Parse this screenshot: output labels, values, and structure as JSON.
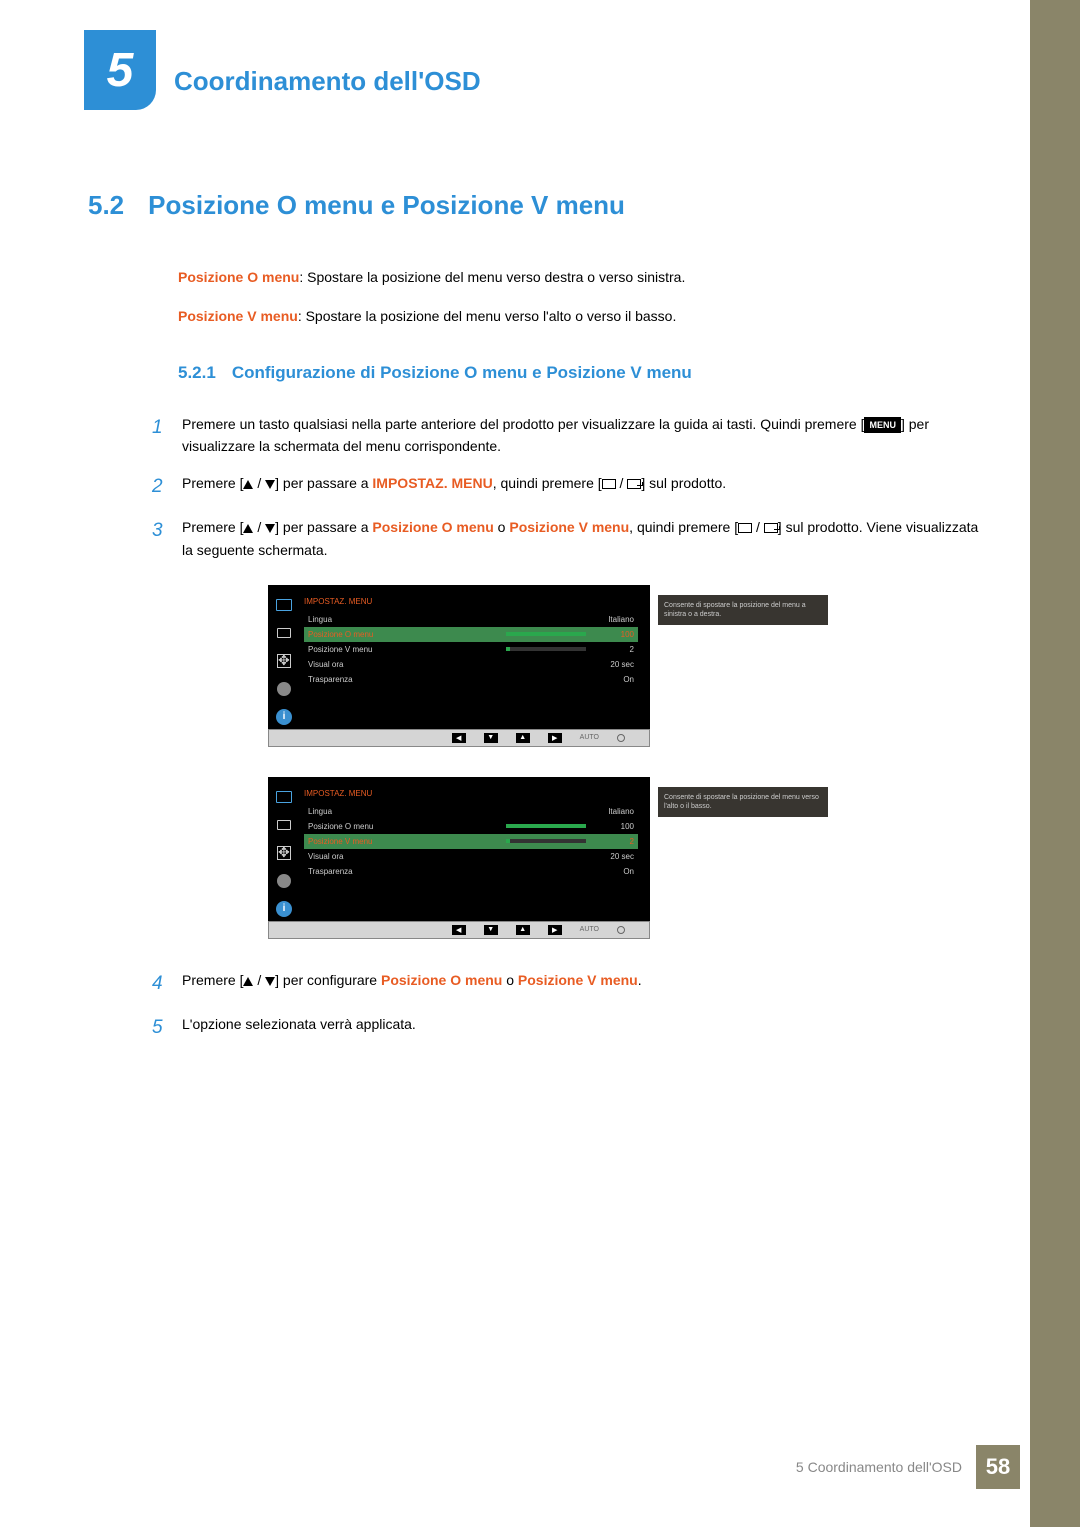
{
  "chapter": {
    "num": "5",
    "title": "Coordinamento dell'OSD"
  },
  "section": {
    "num": "5.2",
    "title": "Posizione O menu e Posizione V menu"
  },
  "paras": {
    "p1key": "Posizione O menu",
    "p1": ": Spostare la posizione del menu verso destra o verso sinistra.",
    "p2key": "Posizione V menu",
    "p2": ": Spostare la posizione del menu verso l'alto o verso il basso."
  },
  "subsection": {
    "num": "5.2.1",
    "title": "Configurazione di Posizione O menu e Posizione V menu"
  },
  "steps": {
    "s1a": "Premere un tasto qualsiasi nella parte anteriore del prodotto per visualizzare la guida ai tasti. Quindi premere [",
    "s1b": "] per visualizzare la schermata del menu corrispondente.",
    "s2a": "Premere [",
    "s2b": "] per passare a ",
    "s2key": "IMPOSTAZ. MENU",
    "s2c": ", quindi premere [",
    "s2d": "] sul prodotto.",
    "s3a": "Premere [",
    "s3b": "] per passare a ",
    "s3key1": "Posizione O menu",
    "s3mid": " o ",
    "s3key2": "Posizione V menu",
    "s3c": ", quindi premere [",
    "s3d": "] sul prodotto. Viene visualizzata la seguente schermata.",
    "s4a": "Premere [",
    "s4b": "] per configurare ",
    "s4key1": "Posizione O menu",
    "s4mid": " o ",
    "s4key2": "Posizione V menu",
    "s4c": ".",
    "s5": "L'opzione selezionata verrà applicata.",
    "menu_lbl": "MENU"
  },
  "osd": {
    "title": "IMPOSTAZ. MENU",
    "rows": {
      "lingua": "Lingua",
      "lingua_v": "Italiano",
      "poso": "Posizione O menu",
      "poso_v": "100",
      "posv": "Posizione V menu",
      "posv_v": "2",
      "visora": "Visual ora",
      "visora_v": "20 sec",
      "trasp": "Trasparenza",
      "trasp_v": "On"
    },
    "tip1": "Consente di spostare la posizione del menu a sinistra o a destra.",
    "tip2": "Consente di spostare la posizione del menu verso l'alto o il basso.",
    "auto": "AUTO"
  },
  "footer": {
    "text": "5 Coordinamento dell'OSD",
    "page": "58"
  }
}
